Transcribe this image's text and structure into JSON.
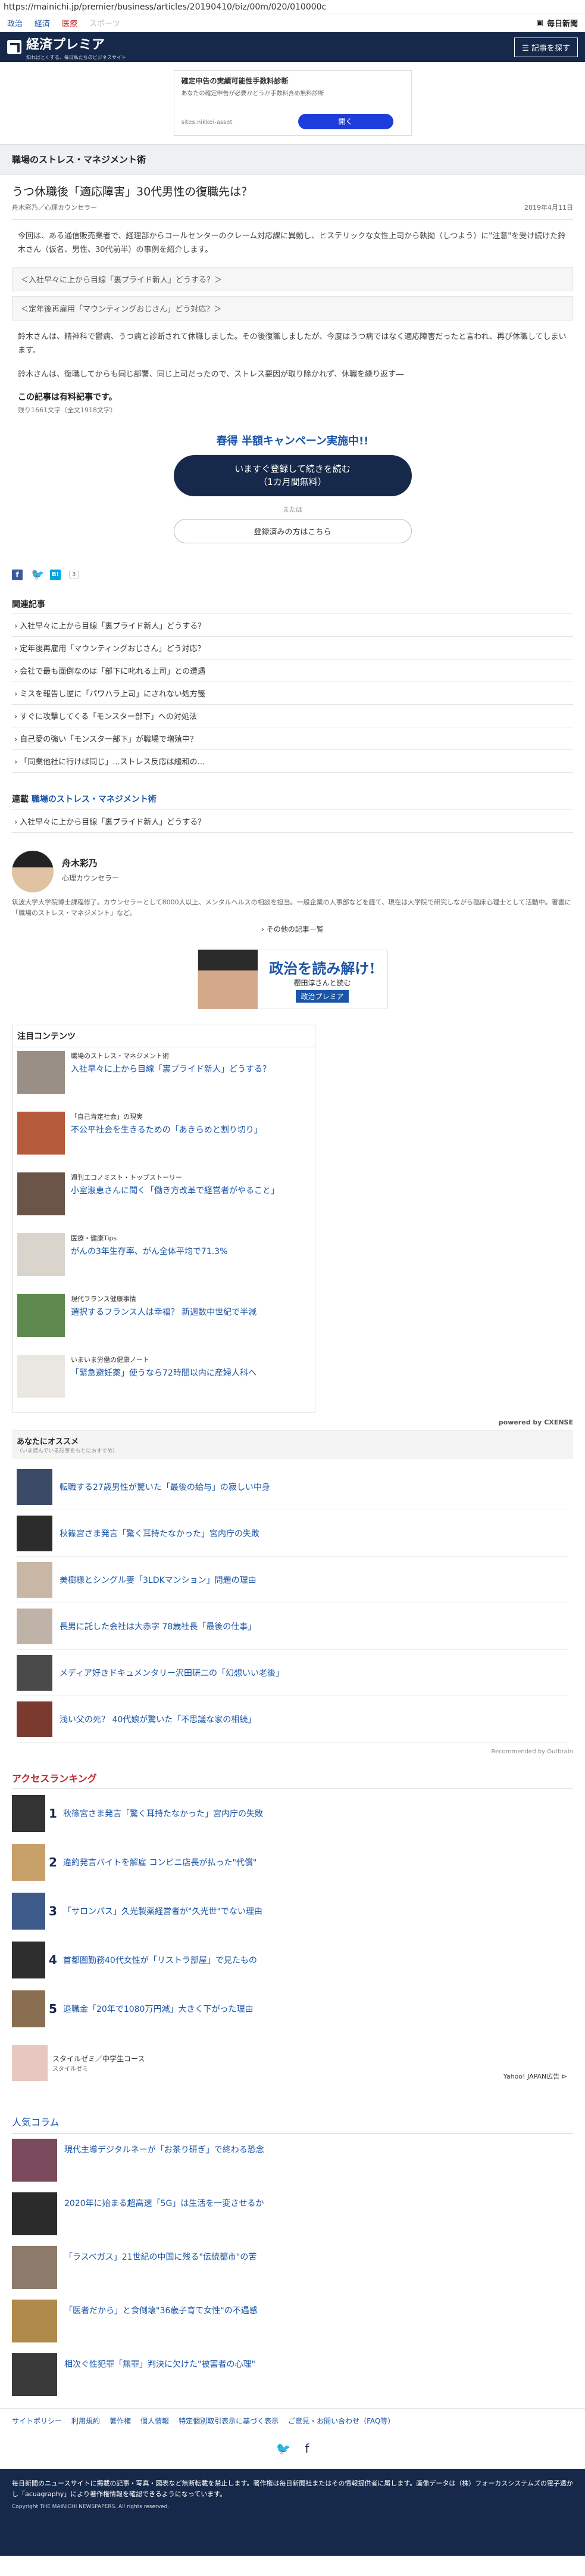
{
  "url": "https://mainichi.jp/premier/business/articles/20190410/biz/00m/020/010000c",
  "topnav": {
    "items": [
      "政治",
      "経済",
      "医療",
      "スポーツ"
    ],
    "brand": "毎日新聞"
  },
  "header": {
    "logo": "経済プレミア",
    "tagline": "知ればとくする、毎日私たちのビジネスサイト",
    "menu_button": "記事を探す"
  },
  "ad_top": {
    "title": "確定申告の実績可能性手数料診断",
    "desc": "あなたの確定申告が必要かどうか手数料含め無料診断",
    "url": "sites.nikkei-asset",
    "button": "開く"
  },
  "section_title": "職場のストレス・マネジメント術",
  "article": {
    "title": "うつ休職後「適応障害」30代男性の復職先は？",
    "author": "舟木彩乃／心理カウンセラー",
    "date": "2019年4月11日",
    "para1": "今回は、ある通信販売業者で、経理部からコールセンターのクレーム対応課に異動し、ヒステリックな女性上司から執拗（しつよう）に\"注意\"を受け続けた鈴木さん（仮名、男性、30代前半）の事例を紹介します。",
    "boxes": [
      "＜入社早々に上から目線「裏プライド新人」どうする？＞",
      "＜定年後再雇用「マウンティングおじさん」どう対応？＞"
    ],
    "para2": "鈴木さんは、精神科で鬱病、うつ病と診断されて休職しました。その後復職しましたが、今度はうつ病ではなく適応障害だったと言われ、再び休職してしまいます。",
    "para3": "鈴木さんは、復職してからも同じ部署、同じ上司だったので、ストレス要因が取り除かれず、休職を繰り返す―",
    "paywall": "この記事は有料記事です。",
    "remaining": "残り1661文字（全文1918文字）"
  },
  "campaign": {
    "title": "春得 半額キャンペーン実施中!!",
    "button_line1": "いますぐ登録して続きを読む",
    "button_line2": "（1カ月間無料）",
    "or": "または",
    "login": "登録済みの方はこちら"
  },
  "share": {
    "count": "3"
  },
  "related": {
    "heading": "関連記事",
    "items": [
      "入社早々に上から目線「裏プライド新人」どうする？",
      "定年後再雇用「マウンティングおじさん」どう対応？",
      "会社で最も面倒なのは「部下に叱れる上司」との遭遇",
      "ミスを報告し逆に「パワハラ上司」にされない処方箋",
      "すぐに攻撃してくる「モンスター部下」への対処法",
      "自己愛の強い「モンスター部下」が職場で増殖中？",
      "「同業他社に行けば同じ」...ストレス反応は緩和の..."
    ]
  },
  "series": {
    "label": "連載",
    "name": "職場のストレス・マネジメント術",
    "item": "入社早々に上から目線「裏プライド新人」どうする？"
  },
  "author_card": {
    "name": "舟木彩乃",
    "role": "心理カウンセラー",
    "bio": "筑波大学大学院博士課程修了。カウンセラーとして8000人以上、メンタルヘルスの相談を担当。一般企業の人事部などを経て、現在は大学院で研究しながら臨床心理士として活動中。著書に「職場のストレス・マネジメント」など。",
    "more": "その他の記事一覧"
  },
  "banner": {
    "line1": "政治を読み解け!",
    "line2": "櫻田淳さんと読む",
    "line3": "政治プレミア"
  },
  "attention": {
    "heading": "注目コンテンツ",
    "items": [
      {
        "cat": "職場のストレス・マネジメント術",
        "title": "入社早々に上から目線「裏プライド新人」どうする？"
      },
      {
        "cat": "「自己肯定社会」の現実",
        "title": "不公平社会を生きるための「あきらめと割り切り」"
      },
      {
        "cat": "週刊エコノミスト・トップストーリー",
        "title": "小室淑恵さんに聞く「働き方改革で経営者がやること」"
      },
      {
        "cat": "医療・健康Tips",
        "title": "がんの3年生存率、がん全体平均で71.3%"
      },
      {
        "cat": "現代フランス健康事情",
        "title": "選択するフランス人は幸福？ 新週数中世紀で半減"
      },
      {
        "cat": "いまいま労働の健康ノート",
        "title": "「緊急避妊薬」使うなら72時間以内に産婦人科へ"
      }
    ],
    "powered": "powered by CXENSE"
  },
  "reco": {
    "heading": "あなたにオススメ",
    "sub": "（いま読んでいる記事をもとにおすすめ）",
    "items": [
      "転職する27歳男性が驚いた「最後の給与」の寂しい中身",
      "秋篠宮さま発言「驚く耳持たなかった」宮内庁の失敗",
      "美樹様とシングル妻「3LDKマンション」問題の理由",
      "長男に託した会社は大赤字 78歳社長「最後の仕事」",
      "メディア好きドキュメンタリー沢田研二の「幻想いい老後」",
      "浅い父の死？ 40代娘が驚いた「不思議な家の相続」"
    ],
    "recommended": "Recommended by Outbrain"
  },
  "ranking": {
    "heading": "アクセスランキング",
    "items": [
      "秋篠宮さま発言「驚く耳持たなかった」宮内庁の失敗",
      "違約発言バイトを解雇 コンビニ店長が払った\"代償\"",
      "「サロンパス」久光製薬経営者が\"久光世\"でない理由",
      "首都圏勤務40代女性が「リストラ部屋」で見たもの",
      "退職金「20年で1080万円減」大きく下がった理由"
    ]
  },
  "promo": {
    "title": "スタイルゼミ／中学生コース",
    "sub": "スタイルゼミ",
    "label": "Yahoo! JAPAN広告 ⊳"
  },
  "columns": {
    "heading": "人気コラム",
    "items": [
      "現代主導デジタルネーが「お茶り研ぎ」で終わる恐念",
      "2020年に始まる超高速「5G」は生活を一変させるか",
      "「ラスベガス」21世紀の中国に残る\"伝統都市\"の苦",
      "「医者だから」と食倒壊\"36歳子育て女性\"の不遇感",
      "相次ぐ性犯罪「無罪」判決に欠けた\"被害者の心理\""
    ]
  },
  "footer": {
    "links": [
      "サイトポリシー",
      "利用規約",
      "著作権",
      "個人情報",
      "特定個別取引表示に基づく表示",
      "ご意見・お問い合わせ（FAQ等）"
    ],
    "notice": "毎日新聞のニュースサイトに掲載の記事・写真・図表など無断転載を禁止します。著作権は毎日新聞社またはその情報提供者に属します。画像データは（株）フォーカスシステムズの電子透かし「acuagraphy」により著作権情報を確認できるようになっています。",
    "copyright": "Copyright THE MAINICHI NEWSPAPERS. All rights reserved."
  }
}
